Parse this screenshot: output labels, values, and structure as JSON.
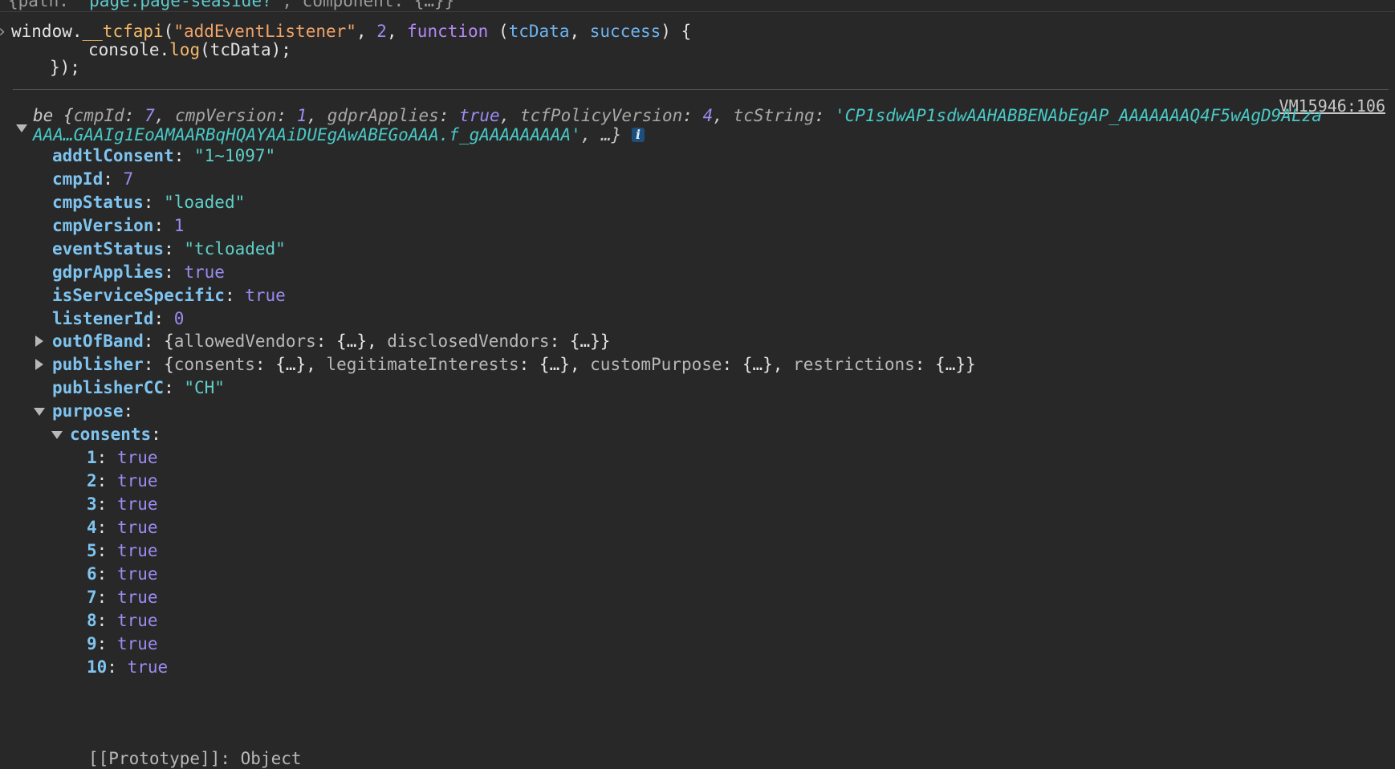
{
  "top_cut_line": {
    "prefix": "{path: ",
    "path_value": "'page:page-seaside?'",
    "rest": ", component: {…}}"
  },
  "input": {
    "line1": {
      "obj": "window.",
      "fn": "__tcfapi",
      "open": "(",
      "arg1": "\"addEventListener\"",
      "sep1": ", ",
      "arg2": "2",
      "sep2": ", ",
      "kw": "function",
      "paren": " (",
      "p1": "tcData",
      "sep3": ", ",
      "p2": "success",
      "close": ") {"
    },
    "line2": {
      "obj": "console.",
      "fn": "log",
      "rest": "(tcData);"
    },
    "line3": "});"
  },
  "source_link": "VM15946:106",
  "summary": {
    "class_name": "be ",
    "open": "{",
    "k1": "cmpId",
    "v1": "7",
    "k2": "cmpVersion",
    "v2": "1",
    "k3": "gdprApplies",
    "v3": "true",
    "k4": "tcfPolicyVersion",
    "v4": "4",
    "k5": "tcString",
    "v5_line1": "'CP1sdwAP1sdwAAHABBENAbEgAP_AAAAAAAQ4F5wAgD9ALza",
    "v5_line2": "AAA…GAAIg1EoAMAARBqHQAYAAiDUEgAwABEGoAAA.f_gAAAAAAAAA'",
    "tail": ", …}",
    "info": "i"
  },
  "properties": [
    {
      "key": "addtlConsent",
      "value": "\"1~1097\"",
      "type": "str"
    },
    {
      "key": "cmpId",
      "value": "7",
      "type": "num"
    },
    {
      "key": "cmpStatus",
      "value": "\"loaded\"",
      "type": "str"
    },
    {
      "key": "cmpVersion",
      "value": "1",
      "type": "num"
    },
    {
      "key": "eventStatus",
      "value": "\"tcloaded\"",
      "type": "str"
    },
    {
      "key": "gdprApplies",
      "value": "true",
      "type": "bool"
    },
    {
      "key": "isServiceSpecific",
      "value": "true",
      "type": "bool"
    },
    {
      "key": "listenerId",
      "value": "0",
      "type": "num"
    }
  ],
  "outOfBand": {
    "key": "outOfBand",
    "preview": {
      "open": "{",
      "k1": "allowedVendors",
      "v1": ": {…}, ",
      "k2": "disclosedVendors",
      "v2": ": {…}}"
    }
  },
  "publisher": {
    "key": "publisher",
    "preview": {
      "open": "{",
      "k1": "consents",
      "v1": ": {…}, ",
      "k2": "legitimateInterests",
      "v2": ": {…}, ",
      "k3": "customPurpose",
      "v3": ": {…}, ",
      "k4": "restrictions",
      "v4": ": {…}}"
    }
  },
  "publisherCC": {
    "key": "publisherCC",
    "value": "\"CH\""
  },
  "purpose": {
    "key": "purpose"
  },
  "consents": {
    "key": "consents",
    "items": [
      {
        "key": "1",
        "value": "true"
      },
      {
        "key": "2",
        "value": "true"
      },
      {
        "key": "3",
        "value": "true"
      },
      {
        "key": "4",
        "value": "true"
      },
      {
        "key": "5",
        "value": "true"
      },
      {
        "key": "6",
        "value": "true"
      },
      {
        "key": "7",
        "value": "true"
      },
      {
        "key": "8",
        "value": "true"
      },
      {
        "key": "9",
        "value": "true"
      },
      {
        "key": "10",
        "value": "true"
      }
    ],
    "cut_line": "[[Prototype]]: Object"
  }
}
